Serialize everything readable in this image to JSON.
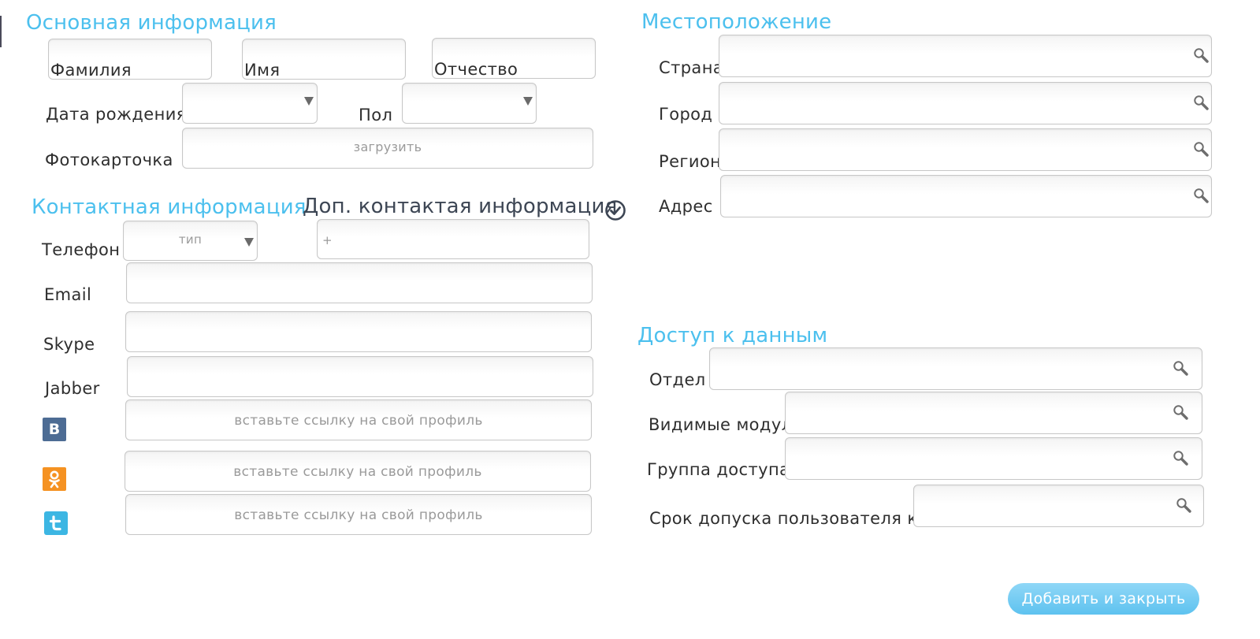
{
  "basic": {
    "heading": "Основная информация",
    "last_name_label": "Фамилия",
    "first_name_label": "Имя",
    "middle_name_label": "Отчество",
    "birth_label": "Дата рождения",
    "gender_label": "Пол",
    "photo_label": "Фотокарточка",
    "upload_label": "загрузить"
  },
  "contact": {
    "heading": "Контактная информация",
    "extra_heading": "Доп. контактая информация",
    "phone_label": "Телефон",
    "phone_type_placeholder": "тип",
    "phone_number_prefix": "+",
    "email_label": "Email",
    "skype_label": "Skype",
    "jabber_label": "Jabber",
    "profile_placeholder": "вставьте ссылку на свой профиль"
  },
  "location": {
    "heading": "Местоположение",
    "country_label": "Страна",
    "city_label": "Город",
    "region_label": "Регион",
    "address_label": "Адрес"
  },
  "access": {
    "heading": "Доступ к данным",
    "department_label": "Отдел",
    "modules_label": "Видимые модули",
    "group_label": "Группа доступа",
    "term_label": "Срок допуска пользователя к ЛК"
  },
  "actions": {
    "submit_label": "Добавить и закрыть"
  },
  "icons": {
    "vk": "vk-icon",
    "ok": "odnoklassniki-icon",
    "twitter": "twitter-icon",
    "search": "magnifier-icon",
    "check": "check-circle-icon"
  },
  "colors": {
    "heading": "#4cc0ee",
    "vk": "#4d6c94",
    "ok": "#f59222",
    "twitter": "#3cb6e3",
    "button": "#6cc8f1"
  }
}
